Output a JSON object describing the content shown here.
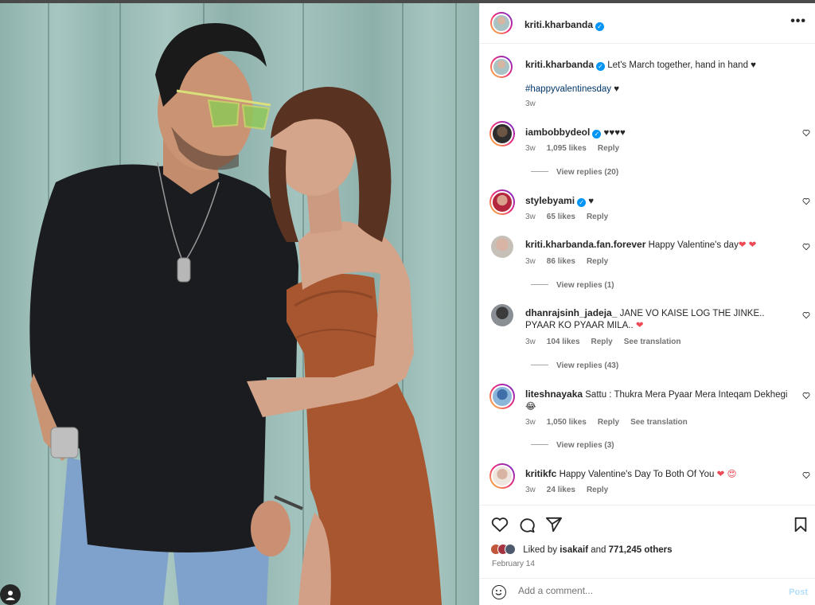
{
  "post": {
    "author": "kriti.kharbanda",
    "caption_text": "Let's March together, hand in hand ♥",
    "caption_hashtag": "#happyvalentinesday",
    "caption_tail": " ♥",
    "caption_age": "3w"
  },
  "header": {
    "more_label": "•••"
  },
  "comments": [
    {
      "user": "iambobbydeol",
      "verified": true,
      "text": "♥♥♥♥",
      "age": "3w",
      "likes": "1,095 likes",
      "reply": "Reply",
      "view_replies": "View replies (20)"
    },
    {
      "user": "stylebyami",
      "verified": true,
      "text": "♥",
      "age": "3w",
      "likes": "65 likes",
      "reply": "Reply"
    },
    {
      "user": "kriti.kharbanda.fan.forever",
      "verified": false,
      "text": "Happy Valentine's day",
      "emoji": "❤ ❤",
      "age": "3w",
      "likes": "86 likes",
      "reply": "Reply",
      "view_replies": "View replies (1)"
    },
    {
      "user": "dhanrajsinh_jadeja_",
      "verified": false,
      "text": "JANE VO KAISE LOG THE JINKE.. PYAAR KO PYAAR MILA..",
      "emoji": "❤",
      "age": "3w",
      "likes": "104 likes",
      "reply": "Reply",
      "translate": "See translation",
      "view_replies": "View replies (43)"
    },
    {
      "user": "liteshnayaka",
      "verified": false,
      "text": "Sattu : Thukra Mera Pyaar Mera Inteqam Dekhegi",
      "emoji": "😂",
      "age": "3w",
      "likes": "1,050 likes",
      "reply": "Reply",
      "translate": "See translation",
      "view_replies": "View replies (3)"
    },
    {
      "user": "kritikfc",
      "verified": false,
      "text": "Happy Valentine's Day To Both Of You",
      "emoji": "❤ 😍",
      "age": "3w",
      "likes": "24 likes",
      "reply": "Reply"
    }
  ],
  "actions": {
    "liked_by_prefix": "Liked by ",
    "liked_by_user": "isakaif",
    "liked_by_mid": " and ",
    "liked_by_count": "771,245 others",
    "date": "February 14"
  },
  "add_comment": {
    "placeholder": "Add a comment...",
    "post_label": "Post"
  },
  "icons": [
    "heart-icon",
    "comment-icon",
    "share-icon",
    "bookmark-icon",
    "emoji-icon",
    "user-tag-icon",
    "more-icon"
  ],
  "colors": {
    "verified": "#0095f6",
    "link": "#00376b",
    "heart": "#ed4956",
    "post_button_disabled": "#b2dffc"
  }
}
